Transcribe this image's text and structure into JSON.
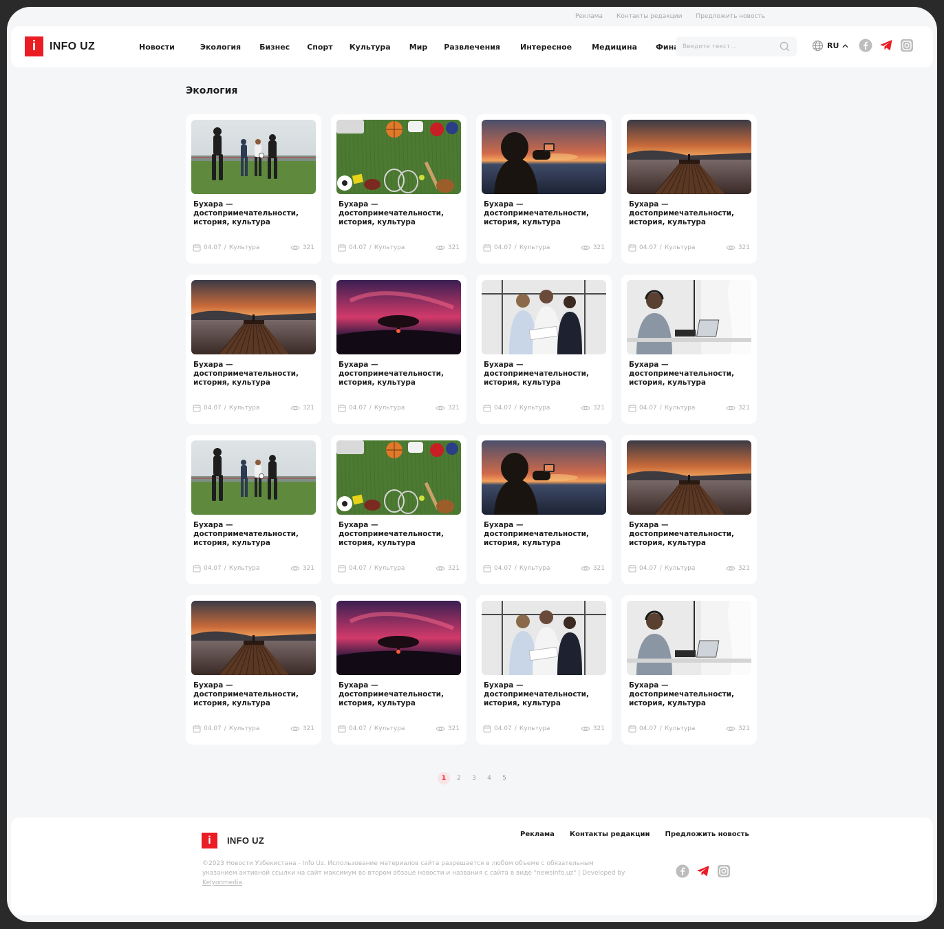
{
  "top_links": [
    "Реклама",
    "Контакты редакции",
    "Предложить новость"
  ],
  "logo": {
    "mark": "i",
    "text": "INFO UZ"
  },
  "nav": [
    "Новости",
    "Экология",
    "Бизнес",
    "Спорт",
    "Культура",
    "Мир",
    "Развлечения",
    "Интересное",
    "Медицина",
    "Финансы"
  ],
  "search": {
    "placeholder": "Введите текст...",
    "icon": "search-icon"
  },
  "lang": {
    "label": "RU",
    "icon": "globe-icon"
  },
  "socials": [
    "facebook-icon",
    "telegram-icon",
    "instagram-icon"
  ],
  "colors": {
    "accent": "#ea1c24",
    "background": "#f5f6f8",
    "card": "#ffffff",
    "muted": "#b0b0b0"
  },
  "page_title": "Экология",
  "cards": [
    {
      "image": "football-players",
      "title": "Бухара — достопримечательности, история, культура",
      "date": "04.07",
      "category": "Культура",
      "views": "321"
    },
    {
      "image": "sports-equipment",
      "title": "Бухара — достопримечательности, история, культура",
      "date": "04.07",
      "category": "Культура",
      "views": "321"
    },
    {
      "image": "woman-photographing-sunset",
      "title": "Бухара — достопримечательности, история, культура",
      "date": "04.07",
      "category": "Культура",
      "views": "321"
    },
    {
      "image": "pier-sunset",
      "title": "Бухара — достопримечательности, история, культура",
      "date": "04.07",
      "category": "Культура",
      "views": "321"
    },
    {
      "image": "pier-sunset",
      "title": "Бухара — достопримечательности, история, культура",
      "date": "04.07",
      "category": "Культура",
      "views": "321"
    },
    {
      "image": "tree-sunset",
      "title": "Бухара — достопримечательности, история, культура",
      "date": "04.07",
      "category": "Культура",
      "views": "321"
    },
    {
      "image": "office-team",
      "title": "Бухара — достопримечательности, история, культура",
      "date": "04.07",
      "category": "Культура",
      "views": "321"
    },
    {
      "image": "woman-headphones-desk",
      "title": "Бухара — достопримечательности, история, культура",
      "date": "04.07",
      "category": "Культура",
      "views": "321"
    },
    {
      "image": "football-players",
      "title": "Бухара — достопримечательности, история, культура",
      "date": "04.07",
      "category": "Культура",
      "views": "321"
    },
    {
      "image": "sports-equipment",
      "title": "Бухара — достопримечательности, история, культура",
      "date": "04.07",
      "category": "Культура",
      "views": "321"
    },
    {
      "image": "woman-photographing-sunset",
      "title": "Бухара — достопримечательности, история, культура",
      "date": "04.07",
      "category": "Культура",
      "views": "321"
    },
    {
      "image": "pier-sunset",
      "title": "Бухара — достопримечательности, история, культура",
      "date": "04.07",
      "category": "Культура",
      "views": "321"
    },
    {
      "image": "pier-sunset",
      "title": "Бухара — достопримечательности, история, культура",
      "date": "04.07",
      "category": "Культура",
      "views": "321"
    },
    {
      "image": "tree-sunset",
      "title": "Бухара — достопримечательности, история, культура",
      "date": "04.07",
      "category": "Культура",
      "views": "321"
    },
    {
      "image": "office-team",
      "title": "Бухара — достопримечательности, история, культура",
      "date": "04.07",
      "category": "Культура",
      "views": "321"
    },
    {
      "image": "woman-headphones-desk",
      "title": "Бухара — достопримечательности, история, культура",
      "date": "04.07",
      "category": "Культура",
      "views": "321"
    }
  ],
  "pagination": {
    "pages": [
      "1",
      "2",
      "3",
      "4",
      "5"
    ],
    "active": "1"
  },
  "footer": {
    "logo_mark": "i",
    "logo_text": "INFO UZ",
    "links": [
      "Реклама",
      "Контакты редакции",
      "Предложить новость"
    ],
    "copyright": "©2023 Новости Узбекистана - Info Uz. Использование материалов сайта разрешается в любом объеме с обязательным указанием активной ссылки на сайт максимум во втором абзаце новости и названия с сайта в виде \"newsinfo.uz\" | Developed by",
    "developer": "Kelyonmedia"
  }
}
